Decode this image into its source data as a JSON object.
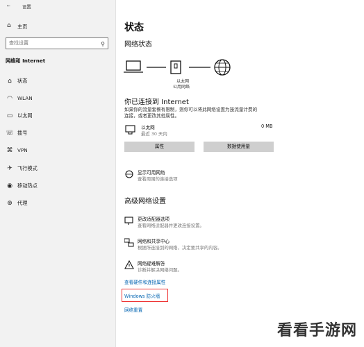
{
  "window": {
    "title": "设置"
  },
  "sidebar": {
    "home_label": "主页",
    "search_placeholder": "查找设置",
    "section_title": "网络和 Internet",
    "items": [
      {
        "label": "状态",
        "icon": "home-status-icon"
      },
      {
        "label": "WLAN",
        "icon": "wifi-icon"
      },
      {
        "label": "以太网",
        "icon": "ethernet-icon"
      },
      {
        "label": "拨号",
        "icon": "dialup-icon"
      },
      {
        "label": "VPN",
        "icon": "vpn-icon"
      },
      {
        "label": "飞行模式",
        "icon": "airplane-icon"
      },
      {
        "label": "移动热点",
        "icon": "hotspot-icon"
      },
      {
        "label": "代理",
        "icon": "globe-icon"
      }
    ]
  },
  "main": {
    "title": "状态",
    "network_status_heading": "网络状态",
    "diagram_label_line1": "以太网",
    "diagram_label_line2": "公用网络",
    "connected_heading": "你已连接到 Internet",
    "connected_desc_line1": "如果你的流量套餐有限制，则你可以将此网络设置为按流量计费的",
    "connected_desc_line2": "连接，或者更改其他属性。",
    "adapter": {
      "name": "以太网",
      "sub": "最近 30 天内",
      "usage": "0 MB"
    },
    "buttons": {
      "properties": "属性",
      "data_usage": "数据使用量"
    },
    "show_networks": {
      "title": "显示可用网络",
      "desc": "查看周围的连接选项"
    },
    "advanced_heading": "高级网络设置",
    "adv_items": [
      {
        "title": "更改适配器选项",
        "desc": "查看网络适配器并更改连接设置。"
      },
      {
        "title": "网络和共享中心",
        "desc": "根据所连接到的网络，决定要共享的内容。"
      },
      {
        "title": "网络疑难解答",
        "desc": "诊断并解决网络问题。"
      }
    ],
    "links": {
      "hardware": "查看硬件和连接属性",
      "firewall": "Windows 防火墙",
      "reset": "网络重置"
    }
  },
  "watermark": "看看手游网",
  "colors": {
    "accent_link": "#0063b1",
    "highlight_border": "#ee3333",
    "sidebar_bg": "#f2f2f2"
  }
}
